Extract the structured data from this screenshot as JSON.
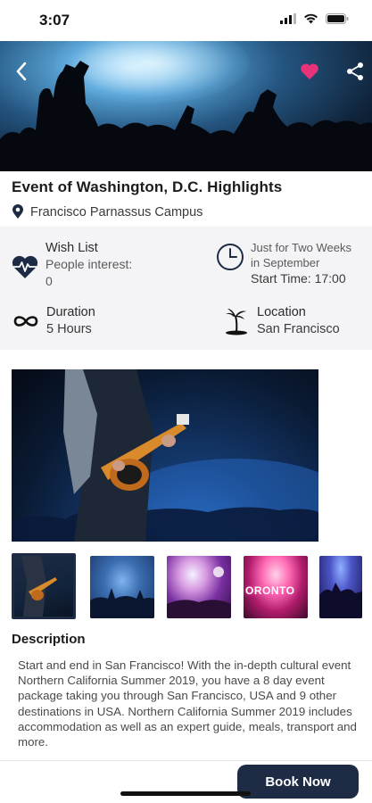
{
  "status_bar": {
    "time": "3:07"
  },
  "hero": {
    "back_icon": "chevron-left-icon",
    "favorite_icon": "heart-icon",
    "share_icon": "share-icon",
    "favorite_color": "#e8337a"
  },
  "event": {
    "title": "Event of Washington, D.C. Highlights",
    "venue": "Francisco Parnassus Campus"
  },
  "info": {
    "wishlist": {
      "label": "Wish List",
      "sub_label": "People interest:",
      "count": "0",
      "icon": "heartbeat-icon"
    },
    "schedule": {
      "line1": "Just for Two Weeks",
      "line2": "in September",
      "start_time": "Start Time: 17:00",
      "icon": "clock-icon"
    },
    "duration": {
      "label": "Duration",
      "value": "5 Hours",
      "icon": "infinity-icon"
    },
    "location": {
      "label": "Location",
      "value": "San Francisco",
      "icon": "palm-island-icon"
    }
  },
  "gallery": {
    "thumbnails": [
      "Guitarist on stage",
      "Concert crowd",
      "Festival lights",
      "TORONTO sign",
      "Concert audience"
    ],
    "sign_text": "ORONTO",
    "selected_index": 0
  },
  "description": {
    "title": "Description",
    "text": "Start and end in San Francisco! With the in-depth cultural event Northern California Summer 2019, you have a 8 day event package taking you through San Francisco, USA and 9 other destinations in USA. Northern California Summer 2019 includes accommodation as well as an expert guide, meals, transport and more."
  },
  "actions": {
    "book_label": "Book Now"
  },
  "colors": {
    "primary": "#1d2b44",
    "accent": "#e8337a",
    "panel_bg": "#f4f4f6"
  }
}
